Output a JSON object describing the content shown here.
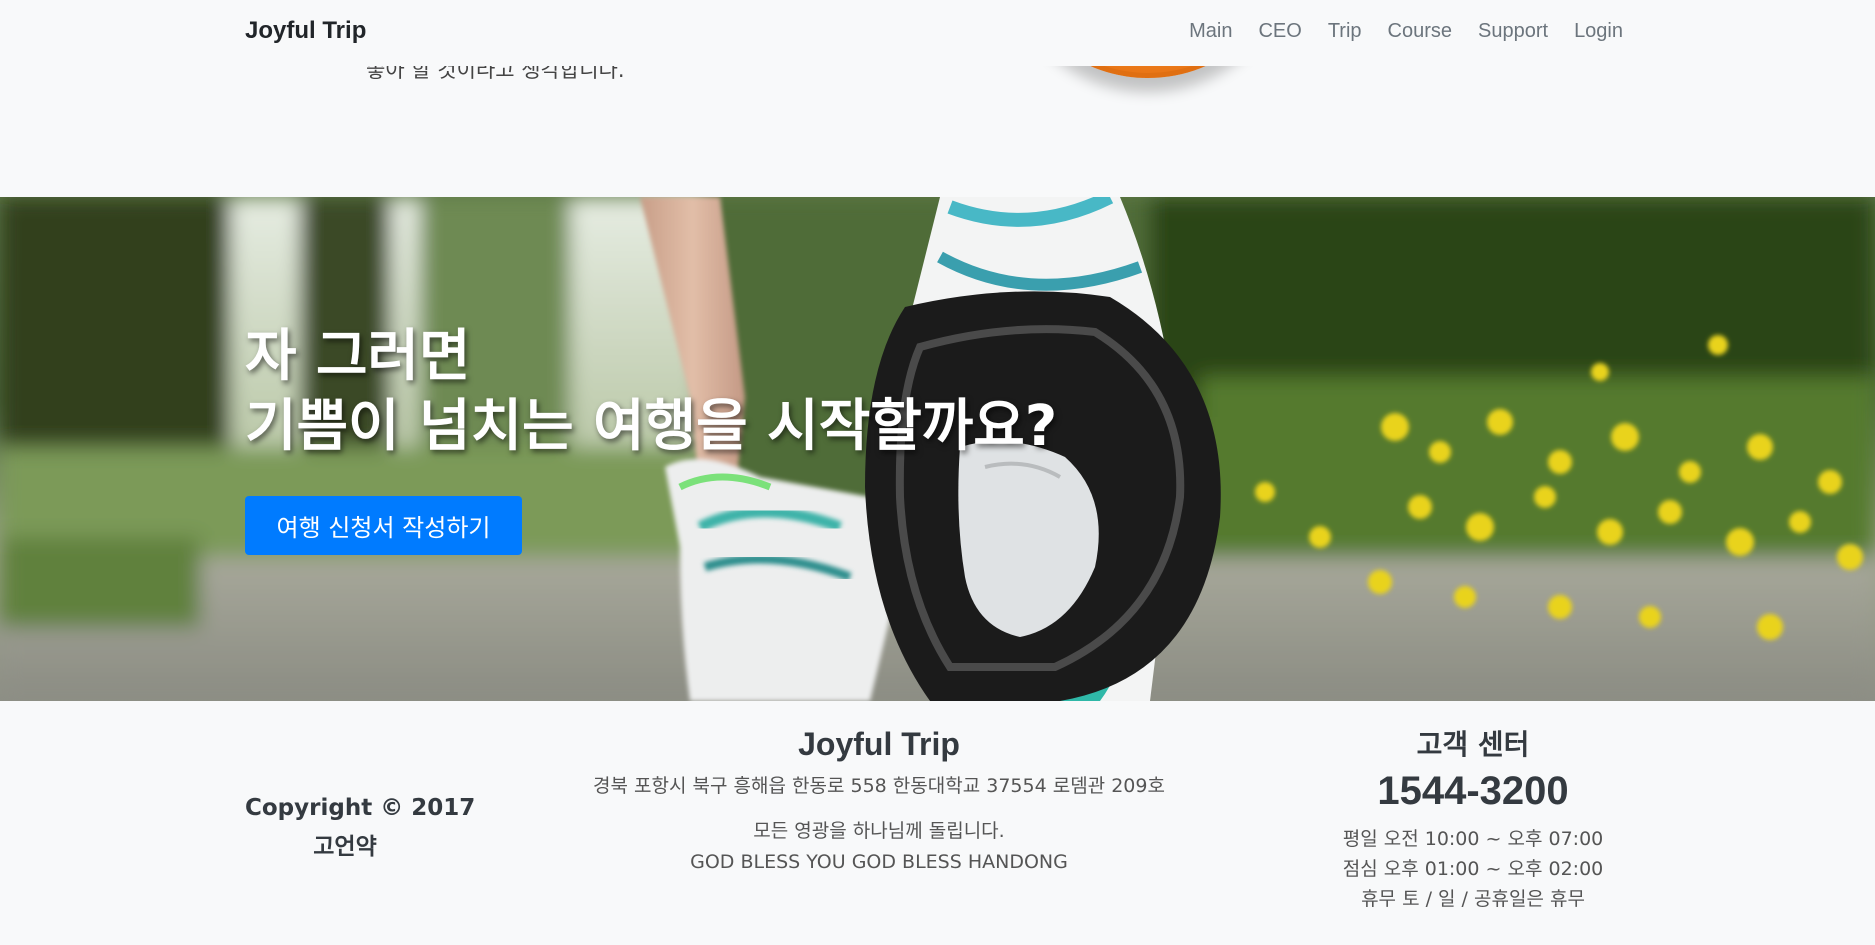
{
  "navbar": {
    "brand": "Joyful Trip",
    "links": [
      "Main",
      "CEO",
      "Trip",
      "Course",
      "Support",
      "Login"
    ]
  },
  "top_section": {
    "cut_text": "좋아 할 것이라고 생각합니다."
  },
  "hero": {
    "title_line1": "자 그러면",
    "title_line2": "기쁨이 넘치는 여행을 시작할까요?",
    "cta_label": "여행 신청서 작성하기",
    "cta_color": "#007bff"
  },
  "footer": {
    "copyright_line1": "Copyright © 2017",
    "copyright_line2": "고언약",
    "brand": "Joyful Trip",
    "address": "경북 포항시 북구 흥해읍 한동로 558 한동대학교 37554 로뎀관 209호",
    "blessing_line1": "모든 영광을 하나님께 돌립니다.",
    "blessing_line2": "GOD BLESS YOU GOD BLESS HANDONG",
    "support_title": "고객 센터",
    "support_phone": "1544-3200",
    "hours_weekday": "평일 오전 10:00 ~ 오후 07:00",
    "hours_lunch": "점심 오후 01:00 ~ 오후 02:00",
    "hours_closed": "휴무 토 / 일 / 공휴일은 휴무"
  }
}
